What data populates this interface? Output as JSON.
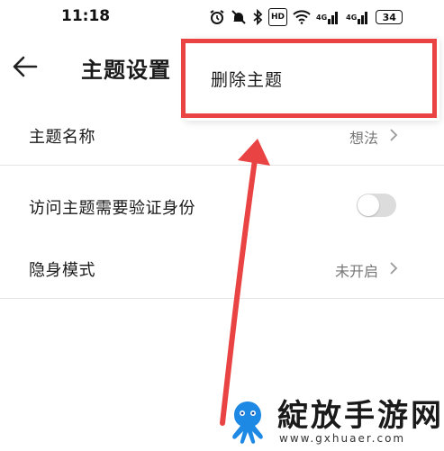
{
  "status_bar": {
    "time": "11:18",
    "hd_label": "HD",
    "signal1_label": "4G",
    "signal2_label": "4G",
    "battery": "34"
  },
  "header": {
    "title": "主题设置"
  },
  "popup_menu": {
    "items": [
      {
        "label": "删除主题"
      }
    ],
    "highlight_color": "#e94343"
  },
  "settings": {
    "rows": [
      {
        "label": "主题名称",
        "value": "想法"
      },
      {
        "label": "访问主题需要验证身份",
        "toggle_on": false
      },
      {
        "label": "隐身模式",
        "value": "未开启"
      }
    ]
  },
  "watermark": {
    "title": "綻放手游网",
    "url": "www.gxhuaer.com",
    "logo_icon": "octopus-logo-icon"
  },
  "colors": {
    "annotation": "#e94343",
    "toggle_off": "#dcdcdc",
    "value_gray": "#777777"
  }
}
